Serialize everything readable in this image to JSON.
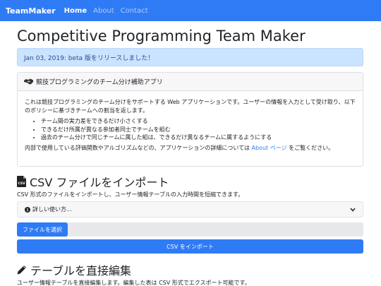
{
  "navbar": {
    "brand": "TeamMaker",
    "links": [
      {
        "label": "Home",
        "active": true
      },
      {
        "label": "About",
        "active": false
      },
      {
        "label": "Contact",
        "active": false
      }
    ]
  },
  "page_title": "Competitive Programming Team Maker",
  "alert": "Jan 03, 2019: beta 版をリリースしました！",
  "info_card": {
    "header": "競技プログラミングのチーム分け補助アプリ",
    "header_icon": "handshake-icon",
    "intro": "これは競技プログラミングのチーム分けをサポートする Web アプリケーションです。ユーザーの情報を入力として受け取り、以下のポリシーに基づきチームへの割当を返します。",
    "policies": [
      "チーム間の実力差をできるだけ小さくする",
      "できるだけ所属が異なる参加者同士でチームを組む",
      "過去のチーム分けで同じチームに属した組は、できるだけ異なるチームに属するようにする"
    ],
    "footer_before": "内部で使用している評価関数やアルゴリズムなどの、アプリケーションの詳細については ",
    "footer_link": "About ページ",
    "footer_after": " をご覧ください。"
  },
  "csv_section": {
    "title": "CSV ファイルをインポート",
    "icon": "csv-file-icon",
    "description": "CSV 形式のファイルをインポートし、ユーザー情報テーブルの入力時間を短縮できます。",
    "usage_toggle": "詳しい使い方...",
    "choose_file": "ファイルを選択",
    "import_button": "CSV をインポート"
  },
  "edit_section": {
    "title": "テーブルを直接編集",
    "icon": "pencil-icon",
    "description": "ユーザー情報テーブルを直接編集します。編集した表は CSV 形式でエクスポート可能です。"
  },
  "colors": {
    "primary": "#2f7bf5",
    "alert_bg": "#cce3ff",
    "alert_text": "#1d4f91"
  }
}
